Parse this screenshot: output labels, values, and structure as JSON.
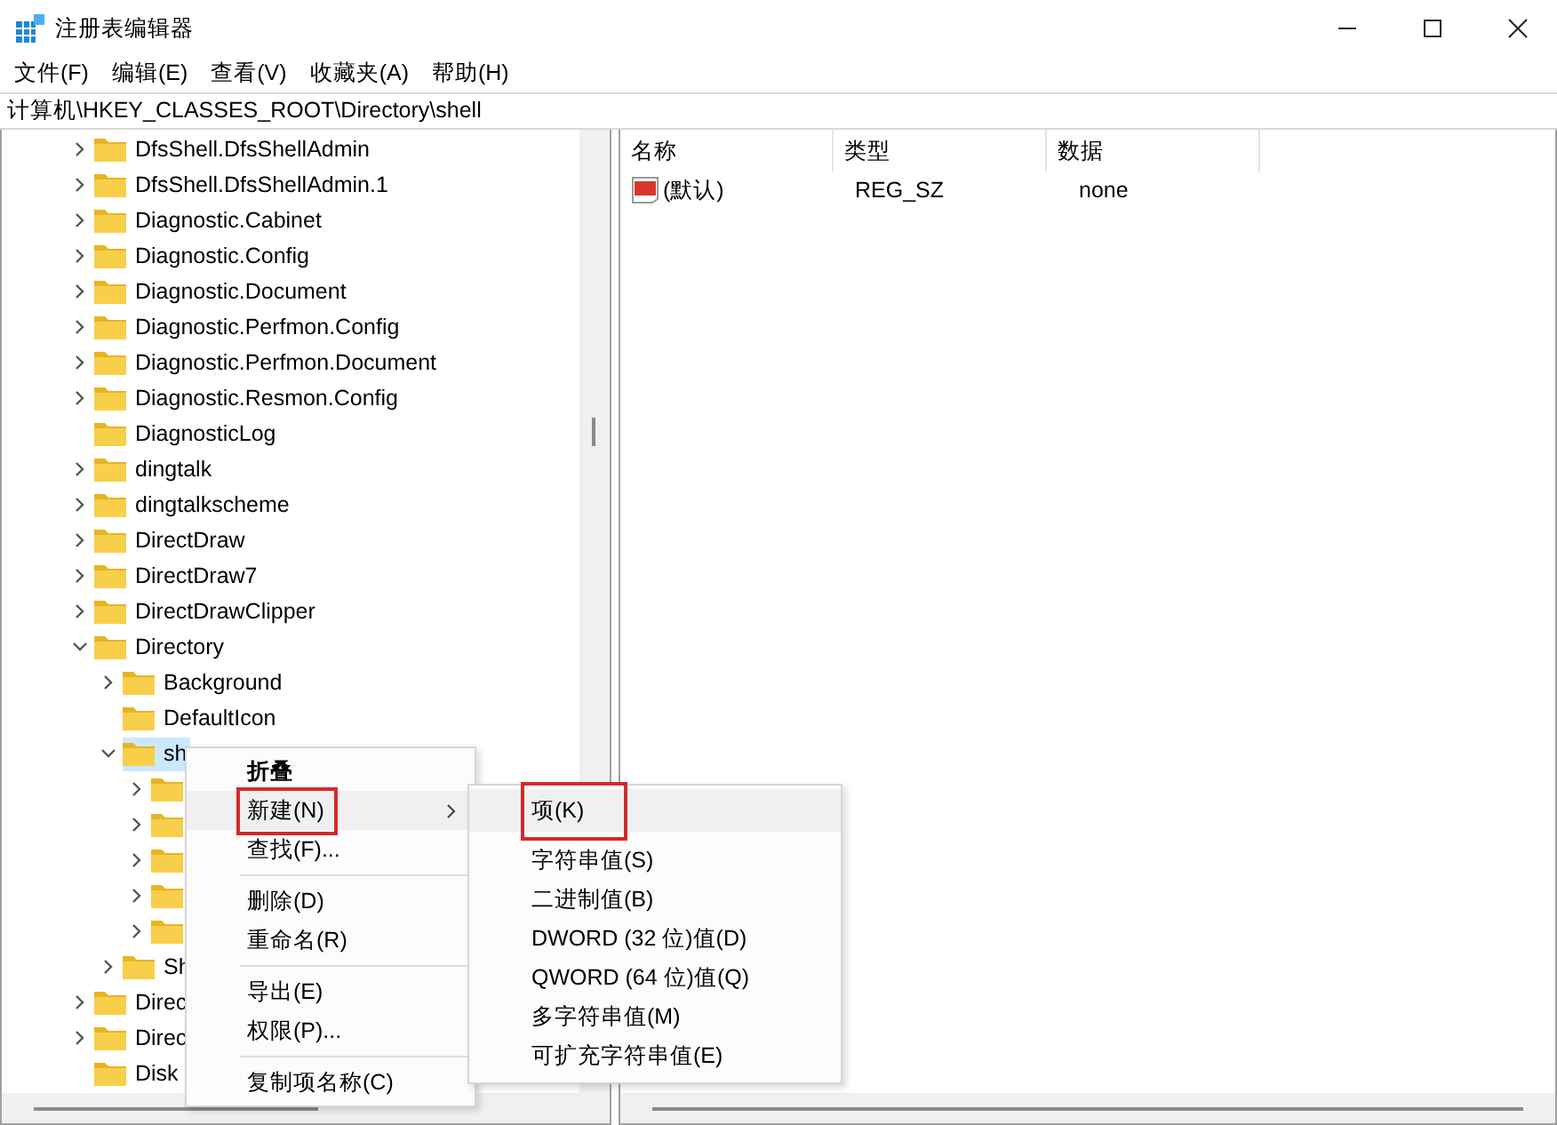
{
  "window": {
    "title": "注册表编辑器"
  },
  "menu_bar": [
    "文件(F)",
    "编辑(E)",
    "查看(V)",
    "收藏夹(A)",
    "帮助(H)"
  ],
  "address_bar": {
    "path": "计算机\\HKEY_CLASSES_ROOT\\Directory\\shell"
  },
  "tree": [
    {
      "label": "DfsShell.DfsShellAdmin",
      "has_children": true,
      "selected": false
    },
    {
      "label": "DfsShell.DfsShellAdmin.1",
      "has_children": true,
      "selected": false
    },
    {
      "label": "Diagnostic.Cabinet",
      "has_children": true,
      "selected": false
    },
    {
      "label": "Diagnostic.Config",
      "has_children": true,
      "selected": false
    },
    {
      "label": "Diagnostic.Document",
      "has_children": true,
      "selected": false
    },
    {
      "label": "Diagnostic.Perfmon.Config",
      "has_children": true,
      "selected": false
    },
    {
      "label": "Diagnostic.Perfmon.Document",
      "has_children": true,
      "selected": false
    },
    {
      "label": "Diagnostic.Resmon.Config",
      "has_children": true,
      "selected": false
    },
    {
      "label": "DiagnosticLog",
      "has_children": false,
      "selected": false
    },
    {
      "label": "dingtalk",
      "has_children": true,
      "selected": false
    },
    {
      "label": "dingtalkscheme",
      "has_children": true,
      "selected": false
    },
    {
      "label": "DirectDraw",
      "has_children": true,
      "selected": false
    },
    {
      "label": "DirectDraw7",
      "has_children": true,
      "selected": false
    },
    {
      "label": "DirectDrawClipper",
      "has_children": true,
      "selected": false
    },
    {
      "label": "Directory",
      "has_children": true,
      "selected": false,
      "children": [
        {
          "label": "Background",
          "has_children": true,
          "selected": false
        },
        {
          "label": "DefaultIcon",
          "has_children": false,
          "selected": false
        },
        {
          "label": "sh",
          "has_children": true,
          "selected": true,
          "children": [
            {
              "has_children": true,
              "selected": false
            },
            {
              "has_children": true,
              "selected": false
            },
            {
              "has_children": true,
              "selected": false
            },
            {
              "has_children": true,
              "selected": false
            },
            {
              "has_children": true,
              "selected": false
            }
          ]
        },
        {
          "label": "Sh",
          "has_children": true,
          "selected": false
        }
      ]
    },
    {
      "label": "Direc",
      "has_children": true,
      "selected": false
    },
    {
      "label": "Direc",
      "has_children": true,
      "selected": false
    },
    {
      "label": "Disk",
      "has_children": false,
      "selected": false
    }
  ],
  "values_table": {
    "columns": [
      "名称",
      "类型",
      "数据"
    ],
    "rows": [
      {
        "name": "(默认)",
        "type": "REG_SZ",
        "data": "none"
      }
    ]
  },
  "context_menu": {
    "items": [
      {
        "kind": "item",
        "label": "折叠",
        "bold": true,
        "highlighted": false,
        "annotated": false,
        "submenu": false
      },
      {
        "kind": "item",
        "label": "新建(N)",
        "bold": false,
        "highlighted": true,
        "annotated": true,
        "submenu": true
      },
      {
        "kind": "item",
        "label": "查找(F)...",
        "bold": false,
        "highlighted": false,
        "annotated": false,
        "submenu": false
      },
      {
        "kind": "separator"
      },
      {
        "kind": "item",
        "label": "删除(D)",
        "bold": false,
        "highlighted": false,
        "annotated": false,
        "submenu": false
      },
      {
        "kind": "item",
        "label": "重命名(R)",
        "bold": false,
        "highlighted": false,
        "annotated": false,
        "submenu": false
      },
      {
        "kind": "separator"
      },
      {
        "kind": "item",
        "label": "导出(E)",
        "bold": false,
        "highlighted": false,
        "annotated": false,
        "submenu": false
      },
      {
        "kind": "item",
        "label": "权限(P)...",
        "bold": false,
        "highlighted": false,
        "annotated": false,
        "submenu": false
      },
      {
        "kind": "separator"
      },
      {
        "kind": "item",
        "label": "复制项名称(C)",
        "bold": false,
        "highlighted": false,
        "annotated": false,
        "submenu": false
      }
    ]
  },
  "submenu": {
    "items": [
      {
        "kind": "item",
        "label": "项(K)",
        "highlighted": true,
        "annotated": true
      },
      {
        "kind": "separator"
      },
      {
        "kind": "item",
        "label": "字符串值(S)",
        "highlighted": false,
        "annotated": false
      },
      {
        "kind": "item",
        "label": "二进制值(B)",
        "highlighted": false,
        "annotated": false
      },
      {
        "kind": "item",
        "label": "DWORD (32 位)值(D)",
        "highlighted": false,
        "annotated": false
      },
      {
        "kind": "item",
        "label": "QWORD (64 位)值(Q)",
        "highlighted": false,
        "annotated": false
      },
      {
        "kind": "item",
        "label": "多字符串值(M)",
        "highlighted": false,
        "annotated": false
      },
      {
        "kind": "item",
        "label": "可扩充字符串值(E)",
        "highlighted": false,
        "annotated": false
      }
    ]
  }
}
